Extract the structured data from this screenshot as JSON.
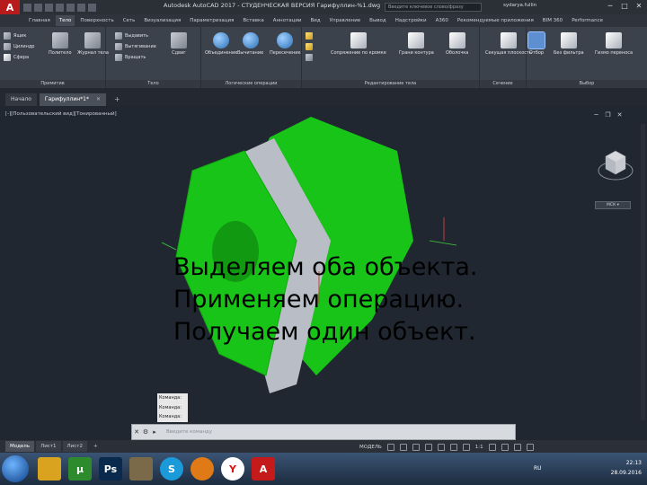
{
  "titlebar": {
    "app_title": "Autodesk AutoCAD 2017 - СТУДЕНЧЕСКАЯ ВЕРСИЯ   Гарифуллин-%1.dwg",
    "search_placeholder": "Введите ключевое слово/фразу",
    "user": "sydarya.fullin"
  },
  "menu_tabs": [
    "Главная",
    "Тело",
    "Поверхность",
    "Сеть",
    "Визуализация",
    "Параметризация",
    "Вставка",
    "Аннотации",
    "Вид",
    "Управление",
    "Вывод",
    "Надстройки",
    "A360",
    "Рекомендуемые приложения",
    "BIM 360",
    "Performance"
  ],
  "active_menu_tab": "Тело",
  "ribbon": {
    "panels": {
      "primitive": "Примитив",
      "body": "Тело",
      "logical": "Логические операции",
      "edit": "Редактирование тела",
      "section": "Сечение",
      "selection": "Выбор"
    },
    "primitive_small": [
      "Ящик",
      "Цилиндр",
      "Сфера"
    ],
    "primitive_big": [
      "Политело",
      "Журнал тела"
    ],
    "body_small": [
      "Выдавить",
      "Вытягивание",
      "Вращать"
    ],
    "body_big": [
      "Сдвиг"
    ],
    "logical_big": [
      "Объединение",
      "Вычитание",
      "Пересечение"
    ],
    "edit_big": [
      "Сопряжение по кромке",
      "Грани контура",
      "Оболочка"
    ],
    "section_big": [
      "Секущая плоскость"
    ],
    "selection_big": [
      "Отбор",
      "Без фильтра",
      "Гизмо переноса"
    ]
  },
  "doc_tabs": [
    {
      "label": "Начало",
      "active": false
    },
    {
      "label": "Гарифуллин*1*",
      "active": true
    }
  ],
  "viewport": {
    "label": "[-][Пользовательский вид][Тонированный]",
    "wcs": "МСК ▾",
    "body_color": "#19c419",
    "cut_color": "#b9bec6"
  },
  "overlay_lines": [
    "Выделяем оба объекта.",
    "Применяем операцию.",
    "Получаем один объект."
  ],
  "command": {
    "history": [
      "Команда:",
      "Команда:",
      "Команда:"
    ],
    "placeholder": "Введите команду"
  },
  "layout_tabs": [
    {
      "label": "Модель",
      "active": true
    },
    {
      "label": "Лист1",
      "active": false
    },
    {
      "label": "Лист2",
      "active": false
    }
  ],
  "status": {
    "model": "МОДЕЛЬ",
    "scale": "1:1"
  },
  "taskbar": {
    "lang": "RU",
    "time": "22:13",
    "date": "28.09.2016",
    "apps": [
      "windows-explorer",
      "utorrent",
      "photoshop",
      "gimp",
      "skype",
      "blender",
      "yandex-browser",
      "autocad"
    ]
  }
}
